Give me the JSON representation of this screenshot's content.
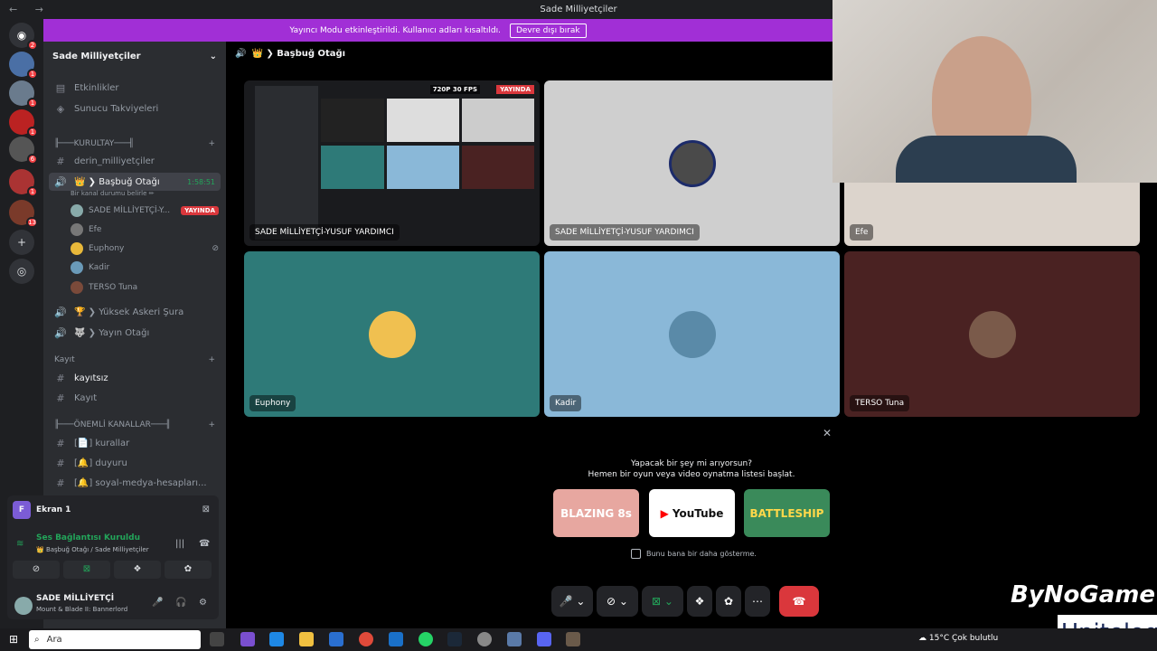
{
  "window": {
    "title": "Sade Milliyetçiler",
    "nav": "← →"
  },
  "banner": {
    "text": "Yayıncı Modu etkinleştirildi. Kullanıcı adları kısaltıldı.",
    "button": "Devre dışı bırak"
  },
  "servers": [
    {
      "badge": "2"
    },
    {
      "badge": "1"
    },
    {
      "badge": "1"
    },
    {
      "badge": "1"
    },
    {
      "badge": "6"
    },
    {
      "badge": "1"
    },
    {
      "badge": ""
    },
    {
      "badge": "13"
    }
  ],
  "sidebar": {
    "guild": "Sade Milliyetçiler",
    "events": "Etkinlikler",
    "boosts": "Sunucu Takviyeleri",
    "cat1": "╟───KURULTAY───╢",
    "ch_derin": "derin_milliyetçiler",
    "voice1": "👑 ❯ Başbuğ Otağı",
    "voice1_time": "1:58:51",
    "voice1_status": "Bir kanal durumu belirle ✏",
    "users": [
      {
        "name": "SADE MİLLİYETÇİ-Y...",
        "live": "YAYINDA"
      },
      {
        "name": "Efe"
      },
      {
        "name": "Euphony"
      },
      {
        "name": "Kadir"
      },
      {
        "name": "TERSO Tuna"
      }
    ],
    "voice2": "🏆 ❯ Yüksek Askeri Şura",
    "voice3": "🐺 ❯ Yayın Otağı",
    "cat2": "Kayıt",
    "ch_kayitsiz": "kayıtsız",
    "ch_kayit": "Kayıt",
    "cat3": "╟───ÖNEMLİ KANALLAR───╢",
    "ch_kurallar": "[📄] kurallar",
    "ch_duyuru": "[🔔] duyuru",
    "ch_sosyal": "[🔔] soyal-medya-hesapları..."
  },
  "panel": {
    "screen": "Ekran 1",
    "voice_status": "Ses Bağlantısı Kuruldu",
    "voice_loc": "👑 Başbuğ Otağı / Sade Milliyetçiler",
    "username": "SADE MİLLİYETÇİ",
    "activity": "Mount & Blade II: Bannerlord"
  },
  "main": {
    "channel": "👑 ❯ Başbuğ Otağı",
    "tiles": [
      {
        "name": "SADE MİLLİYETÇİ-YUSUF YARDIMCI",
        "info": "720P 30 FPS",
        "live": "YAYINDA"
      },
      {
        "name": "SADE MİLLİYETÇİ-YUSUF YARDIMCI"
      },
      {
        "name": "Efe"
      },
      {
        "name": "Euphony"
      },
      {
        "name": "Kadir"
      },
      {
        "name": "TERSO Tuna"
      }
    ],
    "popup": {
      "line1": "Yapacak bir şey mi arıyorsun?",
      "line2": "Hemen bir oyun veya video oynatma listesi başlat.",
      "acts": [
        "BLAZING 8s",
        "YouTube",
        "BATTLESHIP"
      ],
      "checkbox": "Bunu bana bir daha gösterme."
    }
  },
  "taskbar": {
    "search": "Ara",
    "weather": "15°C  Çok bulutlu"
  },
  "watermarks": {
    "brand1": "ByNoGame",
    "brand2": "Unitelog"
  },
  "colors": {
    "accent": "#5865f2",
    "live": "#da373c",
    "banner": "#a12fd6",
    "green": "#23a55a"
  }
}
